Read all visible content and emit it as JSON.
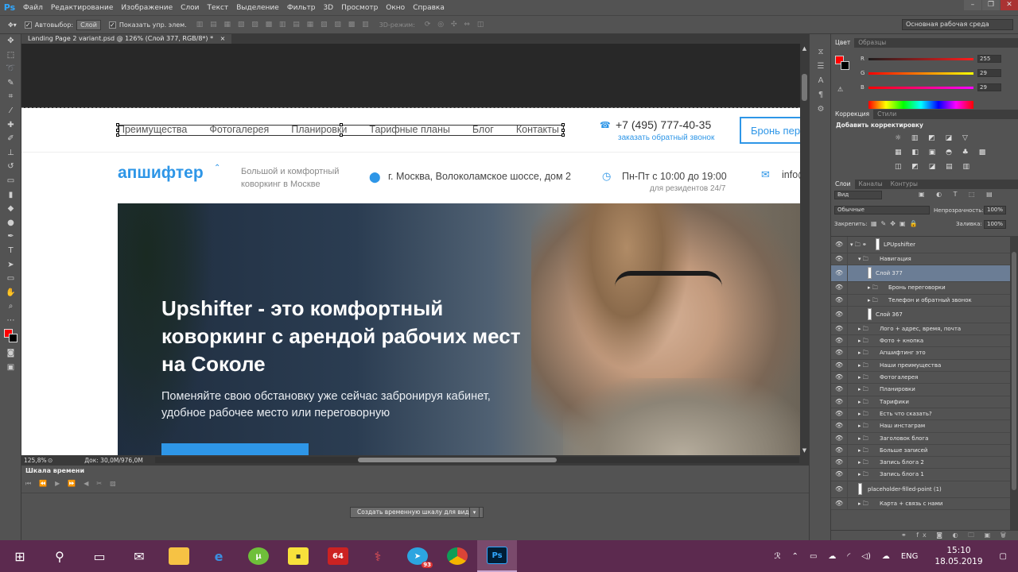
{
  "menubar": {
    "app_logo": "Ps",
    "items": [
      "Файл",
      "Редактирование",
      "Изображение",
      "Слои",
      "Текст",
      "Выделение",
      "Фильтр",
      "3D",
      "Просмотр",
      "Окно",
      "Справка"
    ]
  },
  "options": {
    "autoselect_label": "Автовыбор:",
    "autoselect_value": "Слой",
    "show_controls_label": "Показать упр. элем.",
    "mode3d_label": "3D-режим:",
    "workspace": "Основная рабочая среда"
  },
  "document": {
    "tab_title": "Landing Page 2 variant.psd @ 126% (Слой 377, RGB/8*) *",
    "zoom": "125,8%",
    "doc_info": "Док: 30,0M/976,0M"
  },
  "landing": {
    "nav": [
      "Преимущества",
      "Фотогалерея",
      "Планировки",
      "Тарифные планы",
      "Блог",
      "Контакты"
    ],
    "phone": "+7 (495) 777-40-35",
    "callback": "заказать обратный звонок",
    "book_button": "Бронь переговорки",
    "logo": "апшифтер",
    "tagline": "Большой и комфортный коворкинг в Москве",
    "address": "г. Москва, Волоколамское шоссе, дом 2",
    "hours": "Пн-Пт с 10:00 до 19:00",
    "hours_note": "для резидентов 24/7",
    "email": "info@upshifter.ru",
    "hero_title": "Upshifter - это комфортный коворкинг с арендой рабочих мест на Соколе",
    "hero_subtitle": "Поменяйте свою обстановку уже сейчас забронируя кабинет, удобное рабочее место или переговорную"
  },
  "timeline": {
    "title": "Шкала времени",
    "create_button": "Создать временную шкалу для видео"
  },
  "color_panel": {
    "tabs": [
      "Цвет",
      "Образцы"
    ],
    "channels": [
      {
        "label": "R",
        "value": "255"
      },
      {
        "label": "G",
        "value": "29"
      },
      {
        "label": "B",
        "value": "29"
      }
    ],
    "fg_color": "#ff0000",
    "bg_color": "#000000"
  },
  "adjustments": {
    "tabs": [
      "Коррекция",
      "Стили"
    ],
    "title": "Добавить корректировку"
  },
  "layers": {
    "tabs": [
      "Слои",
      "Каналы",
      "Контуры"
    ],
    "filter": "Вид",
    "blend_mode": "Обычные",
    "opacity_label": "Непрозрачность:",
    "opacity": "100%",
    "lock_label": "Закрепить:",
    "fill_label": "Заливка:",
    "fill": "100%",
    "items": [
      {
        "name": "LPUpshifter"
      },
      {
        "name": "Навигация"
      },
      {
        "name": "Слой 377"
      },
      {
        "name": "Бронь переговорки"
      },
      {
        "name": "Телефон и обратный звонок"
      },
      {
        "name": "Слой 367"
      },
      {
        "name": "Лого + адрес, время, почта"
      },
      {
        "name": "Фото + кнопка"
      },
      {
        "name": "Апшифтинг это"
      },
      {
        "name": "Наши преимущества"
      },
      {
        "name": "Фотогалерея"
      },
      {
        "name": "Планировки"
      },
      {
        "name": "Тарифики"
      },
      {
        "name": "Есть что сказать?"
      },
      {
        "name": "Наш инстаграм"
      },
      {
        "name": "Заголовок блога"
      },
      {
        "name": "Больше записей"
      },
      {
        "name": "Запись блога 2"
      },
      {
        "name": "Запись блога 1"
      },
      {
        "name": "placeholder-filled-point (1)"
      },
      {
        "name": "Карта + связь с нами"
      }
    ]
  },
  "taskbar": {
    "badge_64": "64",
    "telegram_badge": "93",
    "ps_label": "Ps",
    "language": "ENG",
    "time": "15:10",
    "date": "18.05.2019"
  }
}
